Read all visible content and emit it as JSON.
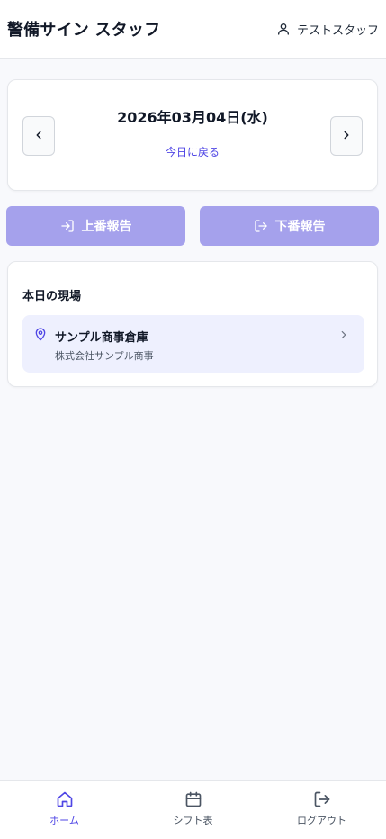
{
  "header": {
    "app_title": "警備サイン スタッフ",
    "user_name": "テストスタッフ",
    "user_icon": "user-icon"
  },
  "date_nav": {
    "date": "2026年03月04日(水)",
    "today_link": "今日に戻る",
    "prev_icon": "chevron-left-icon",
    "next_icon": "chevron-right-icon"
  },
  "actions": {
    "start_report": "上番報告",
    "start_icon": "log-in-icon",
    "end_report": "下番報告",
    "end_icon": "log-out-icon",
    "button_color": "#a5a1ec"
  },
  "sites": {
    "title": "本日の現場",
    "items": [
      {
        "name": "サンプル商事倉庫",
        "company": "株式会社サンプル商事",
        "icon": "map-pin-icon"
      }
    ]
  },
  "bottom_nav": {
    "items": [
      {
        "label": "ホーム",
        "icon": "home-icon",
        "active": true
      },
      {
        "label": "シフト表",
        "icon": "calendar-icon",
        "active": false
      },
      {
        "label": "ログアウト",
        "icon": "log-out-icon",
        "active": false
      }
    ]
  },
  "colors": {
    "accent": "#4f46e5",
    "site_bg": "#eef0fe",
    "page_bg": "#f8f9fc"
  }
}
